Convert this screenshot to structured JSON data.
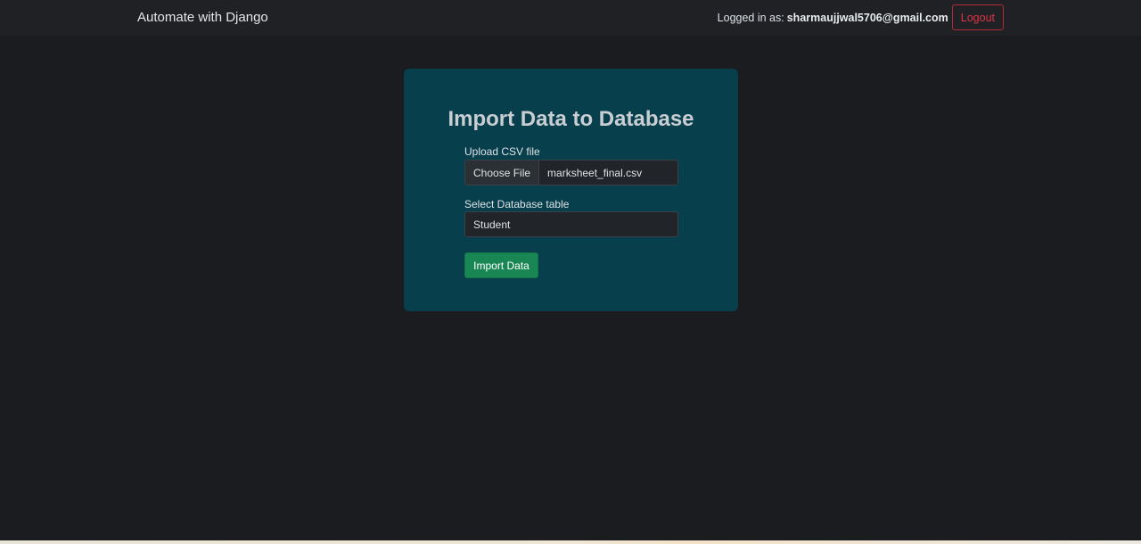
{
  "navbar": {
    "brand": "Automate with Django",
    "logged_in_label": "Logged in as:",
    "user_email": "sharmaujjwal5706@gmail.com",
    "logout_label": "Logout"
  },
  "form": {
    "title": "Import Data to Database",
    "file_label": "Upload CSV file",
    "choose_file_label": "Choose File",
    "file_name": "marksheet_final.csv",
    "table_label": "Select Database table",
    "table_selected": "Student",
    "submit_label": "Import Data"
  },
  "colors": {
    "background": "#1a1c1f",
    "navbar": "#1f2124",
    "card": "#073f4c",
    "primary_action": "#198754",
    "danger": "#dc3545"
  }
}
